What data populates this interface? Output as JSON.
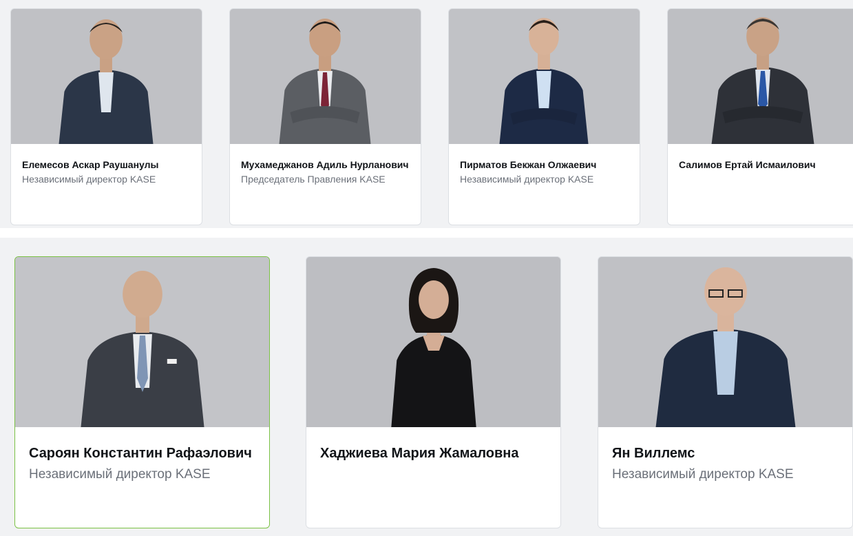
{
  "colors": {
    "accent": "#7ac143",
    "band_bg": "#f1f2f4",
    "photo_bg": "#bdbec2"
  },
  "people_top": [
    {
      "name": "Елемесов Аскар Раушанулы",
      "role": "Независимый директор KASE"
    },
    {
      "name": "Мухамеджанов Адиль Нурланович",
      "role": "Председатель Правления KASE"
    },
    {
      "name": "Пирматов Бекжан Олжаевич",
      "role": "Независимый директор KASE"
    },
    {
      "name": "Салимов Ертай Исмаилович",
      "role": ""
    }
  ],
  "people_bottom": [
    {
      "name": "Сароян Константин Рафаэлович",
      "role": "Независимый директор KASE"
    },
    {
      "name": "Хаджиева Мария Жамаловна",
      "role": ""
    },
    {
      "name": "Ян Виллемс",
      "role": "Независимый директор KASE"
    }
  ]
}
